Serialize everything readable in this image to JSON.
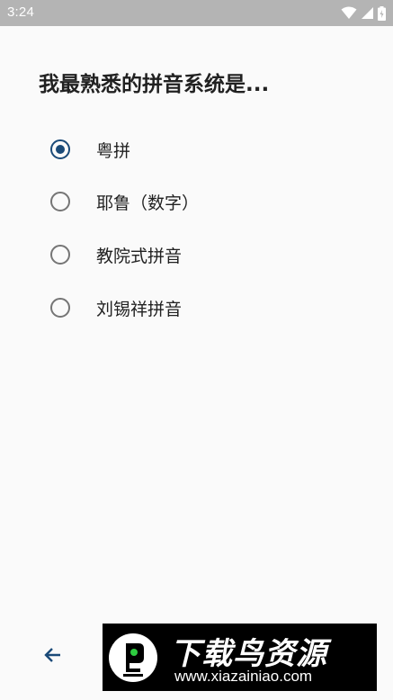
{
  "status_bar": {
    "time": "3:24",
    "icons": [
      "wifi-icon",
      "cellular-signal-icon",
      "battery-icon"
    ],
    "background": "#b4b4b4"
  },
  "question": {
    "text": "我最熟悉的拼音系统是..."
  },
  "options": [
    {
      "label": "粤拼",
      "selected": true
    },
    {
      "label": "耶鲁（数字）",
      "selected": false
    },
    {
      "label": "教院式拼音",
      "selected": false
    },
    {
      "label": "刘锡祥拼音",
      "selected": false
    }
  ],
  "navigation": {
    "back_icon": "arrow-left-icon"
  },
  "watermark": {
    "title": "下载鸟资源",
    "url": "www.xiazainiao.com"
  },
  "colors": {
    "accent": "#1a4a78",
    "text": "#212121",
    "background": "#fafafa"
  }
}
